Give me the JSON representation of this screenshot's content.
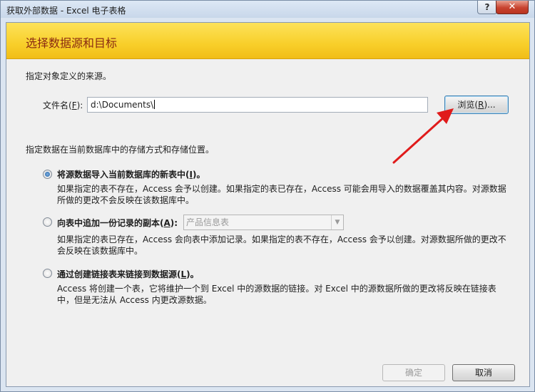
{
  "window": {
    "title": "获取外部数据 - Excel 电子表格",
    "help": "?",
    "close": "✕"
  },
  "header": {
    "title": "选择数据源和目标"
  },
  "source": {
    "instruction": "指定对象定义的来源。",
    "file_label": "文件名(",
    "file_label_key": "F",
    "file_label_end": "):",
    "file_value": "d:\\Documents\\",
    "browse_label": "浏览(",
    "browse_key": "R",
    "browse_end": ")..."
  },
  "storage": {
    "instruction": "指定数据在当前数据库中的存储方式和存储位置。",
    "options": [
      {
        "label": "将源数据导入当前数据库的新表中(",
        "key": "I",
        "end": ")。",
        "checked": true,
        "desc": "如果指定的表不存在，Access 会予以创建。如果指定的表已存在，Access 可能会用导入的数据覆盖其内容。对源数据所做的更改不会反映在该数据库中。"
      },
      {
        "label": "向表中追加一份记录的副本(",
        "key": "A",
        "end": "):",
        "checked": false,
        "desc": "如果指定的表已存在，Access 会向表中添加记录。如果指定的表不存在，Access 会予以创建。对源数据所做的更改不会反映在该数据库中。"
      },
      {
        "label": "通过创建链接表来链接到数据源(",
        "key": "L",
        "end": ")。",
        "checked": false,
        "desc": "Access 将创建一个表，它将维护一个到 Excel 中的源数据的链接。对 Excel 中的源数据所做的更改将反映在链接表中，但是无法从 Access 内更改源数据。"
      }
    ],
    "append_table_select": "产品信息表"
  },
  "footer": {
    "ok_label": "确定",
    "cancel_label": "取消"
  },
  "colors": {
    "header_band": "#f8cf2a",
    "header_text": "#8a2a12",
    "annotation_arrow": "#e01b1b"
  }
}
